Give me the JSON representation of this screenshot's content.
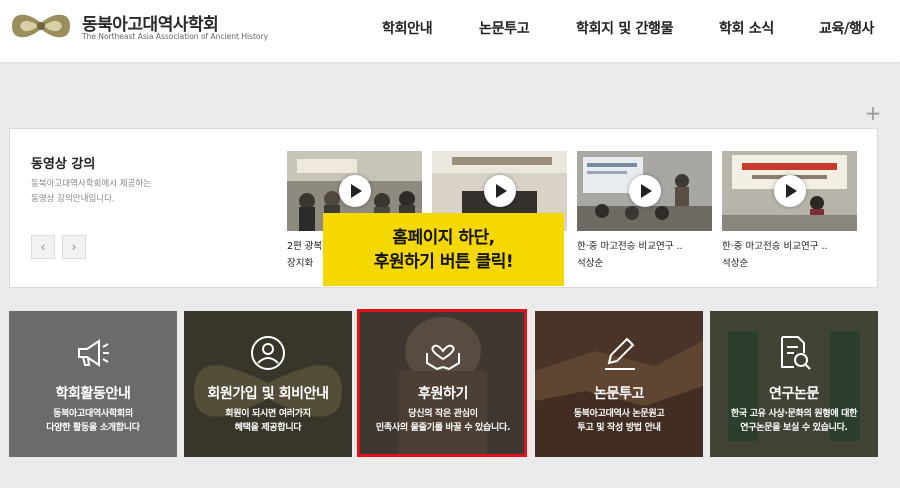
{
  "header": {
    "brand_ko": "동북아고대역사학회",
    "brand_en": "The Northeast Asia Association of Ancient History",
    "nav": [
      "학회안내",
      "논문투고",
      "학회지 및 간행물",
      "학회 소식",
      "교육/행사"
    ]
  },
  "video_section": {
    "title": "동영상 강의",
    "desc_line1": "동북아고대역사학회에서 제공하는",
    "desc_line2": "동영상 강의안내입니다.",
    "prev": "‹",
    "next": "›",
    "videos": [
      {
        "title": "2편 광복",
        "author": "장지화"
      },
      {
        "title": "",
        "author": ""
      },
      {
        "title": "한·중 마고전승 비교연구 ..",
        "author": "석상순"
      },
      {
        "title": "한·중 마고전승 비교연구 ..",
        "author": "석상순"
      }
    ]
  },
  "overlay": {
    "line1": "홈페이지 하단,",
    "line2": "후원하기 버튼 클릭!"
  },
  "tiles": [
    {
      "title": "학회활동안내",
      "desc1": "동북아고대역사학회의",
      "desc2": "다양한 활동을 소개합니다",
      "icon": "megaphone-icon"
    },
    {
      "title": "회원가입 및 회비안내",
      "desc1": "회원이 되시면 여러가지",
      "desc2": "혜택을 제공합니다",
      "icon": "user-icon"
    },
    {
      "title": "후원하기",
      "desc1": "당신의 작은 관심이",
      "desc2": "민족사의 물줄기를 바꿀 수 있습니다.",
      "icon": "heart-hands-icon"
    },
    {
      "title": "논문투고",
      "desc1": "동북아고대역사 논문원고",
      "desc2": "투고 및 작성 방법 안내",
      "icon": "pen-icon"
    },
    {
      "title": "연구논문",
      "desc1": "한국 고유 사상·문화의 원형에 대한",
      "desc2": "연구논문을 보실 수 있습니다.",
      "icon": "document-search-icon"
    }
  ],
  "colors": {
    "overlay": "#f5d800",
    "highlight": "#e0101c",
    "tile_gray": "#6b6b6b"
  }
}
